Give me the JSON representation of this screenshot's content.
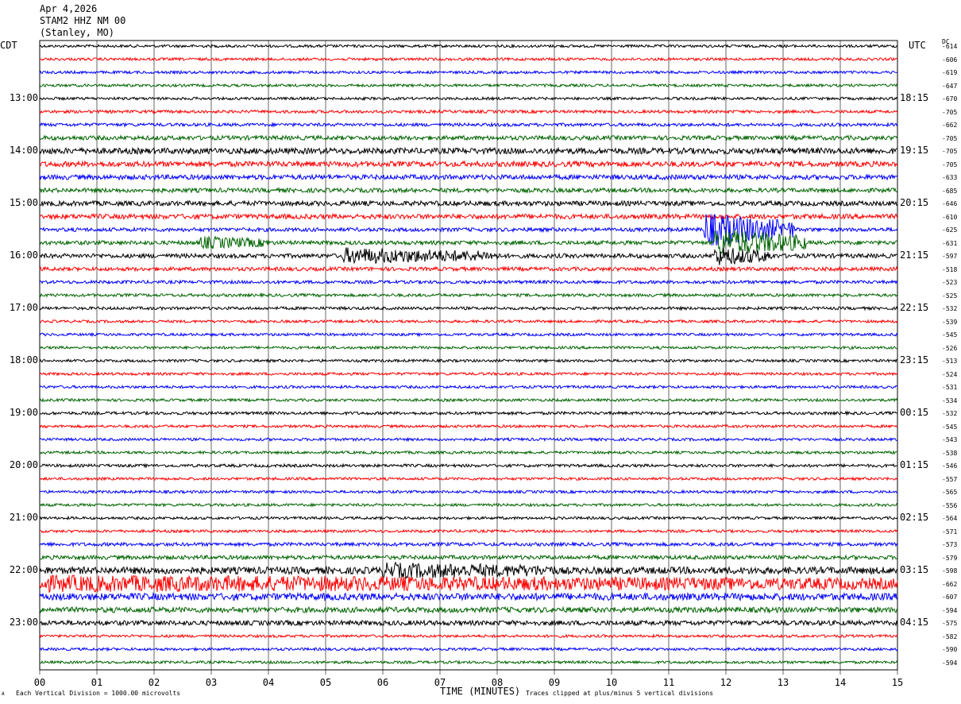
{
  "header": {
    "date": "Apr 4,2026",
    "station": "STAM2 HHZ NM 00",
    "location": "(Stanley, MO)"
  },
  "left_axis_title": "CDT",
  "right_axis_title": "UTC",
  "dc_title": "DC",
  "footer": {
    "left_mark": "A",
    "scale": "Each Vertical Division = 1000.00 microvolts",
    "xlabel": "TIME (MINUTES)",
    "clip": "Traces clipped at plus/minus 5 vertical divisions"
  },
  "colors": {
    "trace_cycle": [
      "#000000",
      "#ff0000",
      "#0000ff",
      "#006400"
    ],
    "grid": "#000000"
  },
  "chart_data": {
    "type": "line",
    "title": "Apr 4,2026 STAM2 HHZ NM 00 (Stanley, MO)",
    "xlabel": "TIME (MINUTES)",
    "ylabel": "",
    "xlim": [
      0,
      15
    ],
    "x_ticks": [
      "00",
      "01",
      "02",
      "03",
      "04",
      "05",
      "06",
      "07",
      "08",
      "09",
      "10",
      "11",
      "12",
      "13",
      "14",
      "15"
    ],
    "grid": "vertical lines at each minute",
    "num_traces": 48,
    "minutes_per_trace": 15,
    "left_ticks": [
      {
        "trace": 4,
        "label": "13:00"
      },
      {
        "trace": 8,
        "label": "14:00"
      },
      {
        "trace": 12,
        "label": "15:00"
      },
      {
        "trace": 16,
        "label": "16:00"
      },
      {
        "trace": 20,
        "label": "17:00"
      },
      {
        "trace": 24,
        "label": "18:00"
      },
      {
        "trace": 28,
        "label": "19:00"
      },
      {
        "trace": 32,
        "label": "20:00"
      },
      {
        "trace": 36,
        "label": "21:00"
      },
      {
        "trace": 40,
        "label": "22:00"
      },
      {
        "trace": 44,
        "label": "23:00"
      }
    ],
    "right_ticks": [
      {
        "trace": 4,
        "label": "18:15"
      },
      {
        "trace": 8,
        "label": "19:15"
      },
      {
        "trace": 12,
        "label": "20:15"
      },
      {
        "trace": 16,
        "label": "21:15"
      },
      {
        "trace": 20,
        "label": "22:15"
      },
      {
        "trace": 24,
        "label": "23:15"
      },
      {
        "trace": 28,
        "label": "00:15"
      },
      {
        "trace": 32,
        "label": "01:15"
      },
      {
        "trace": 36,
        "label": "02:15"
      },
      {
        "trace": 40,
        "label": "03:15"
      },
      {
        "trace": 44,
        "label": "04:15"
      }
    ],
    "dc_offsets": [
      "-614",
      "-606",
      "-619",
      "-647",
      "-670",
      "-705",
      "-662",
      "-705",
      "-705",
      "-705",
      "-633",
      "-685",
      "-646",
      "-610",
      "-625",
      "-631",
      "-597",
      "-518",
      "-523",
      "-525",
      "-532",
      "-539",
      "-545",
      "-526",
      "-513",
      "-524",
      "-531",
      "-534",
      "-532",
      "-545",
      "-543",
      "-538",
      "-546",
      "-557",
      "-565",
      "-556",
      "-564",
      "-571",
      "-573",
      "-579",
      "-598",
      "-662",
      "-607",
      "-594",
      "-575",
      "-582",
      "-590",
      "-594"
    ],
    "noise_level": [
      1.0,
      1.0,
      1.0,
      1.0,
      1.0,
      1.1,
      1.2,
      1.6,
      2.2,
      2.0,
      1.8,
      1.6,
      1.8,
      1.8,
      1.4,
      1.5,
      1.6,
      1.4,
      1.2,
      1.1,
      1.1,
      1.0,
      1.0,
      1.0,
      1.0,
      1.0,
      1.0,
      1.0,
      1.1,
      1.0,
      1.0,
      1.0,
      1.1,
      1.0,
      1.0,
      1.0,
      1.0,
      1.0,
      1.3,
      1.5,
      2.6,
      2.8,
      2.6,
      2.0,
      1.8,
      1.0,
      1.0,
      1.0
    ],
    "events": [
      {
        "trace": 14,
        "start_min": 11.6,
        "end_min": 13.2,
        "amplitude": 5
      },
      {
        "trace": 15,
        "start_min": 11.8,
        "end_min": 13.4,
        "amplitude": 4
      },
      {
        "trace": 16,
        "start_min": 5.3,
        "end_min": 8.0,
        "amplitude": 2
      },
      {
        "trace": 16,
        "start_min": 11.8,
        "end_min": 12.8,
        "amplitude": 2.5
      },
      {
        "trace": 15,
        "start_min": 2.8,
        "end_min": 4.0,
        "amplitude": 1.5
      },
      {
        "trace": 41,
        "start_min": 0.0,
        "end_min": 15.0,
        "amplitude": 1.5
      },
      {
        "trace": 40,
        "start_min": 6.0,
        "end_min": 9.0,
        "amplitude": 1.5
      }
    ]
  }
}
